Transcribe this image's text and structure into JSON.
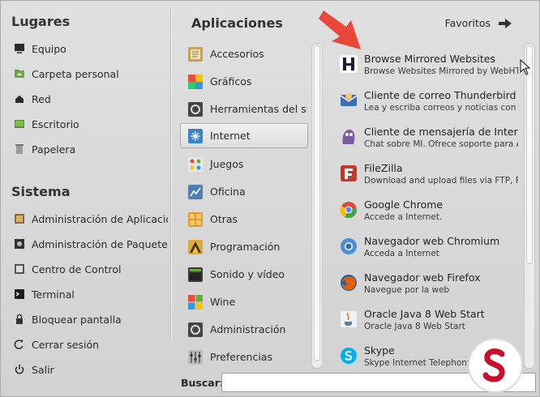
{
  "places": {
    "title": "Lugares",
    "items": [
      {
        "label": "Equipo",
        "icon": "computer-icon"
      },
      {
        "label": "Carpeta personal",
        "icon": "home-folder-icon"
      },
      {
        "label": "Red",
        "icon": "network-icon"
      },
      {
        "label": "Escritorio",
        "icon": "desktop-icon"
      },
      {
        "label": "Papelera",
        "icon": "trash-icon"
      }
    ]
  },
  "system": {
    "title": "Sistema",
    "items": [
      {
        "label": "Administración de Aplicaciones",
        "icon": "software-manager-icon"
      },
      {
        "label": "Administración de Paquetes",
        "icon": "package-manager-icon"
      },
      {
        "label": "Centro de Control",
        "icon": "control-center-icon"
      },
      {
        "label": "Terminal",
        "icon": "terminal-icon"
      },
      {
        "label": "Bloquear pantalla",
        "icon": "lock-icon"
      },
      {
        "label": "Cerrar sesión",
        "icon": "logout-icon"
      },
      {
        "label": "Salir",
        "icon": "power-icon"
      }
    ]
  },
  "applications": {
    "title": "Aplicaciones",
    "categories": [
      {
        "label": "Accesorios",
        "icon": "accessories-icon",
        "color": "#c9a15a"
      },
      {
        "label": "Gráficos",
        "icon": "graphics-icon",
        "color": "#8c4bd6"
      },
      {
        "label": "Herramientas del sistema",
        "icon": "system-tools-icon",
        "color": "#555555"
      },
      {
        "label": "Internet",
        "icon": "internet-icon",
        "color": "#3a83c9",
        "selected": true
      },
      {
        "label": "Juegos",
        "icon": "games-icon",
        "color": "#6aaa3a"
      },
      {
        "label": "Oficina",
        "icon": "office-icon",
        "color": "#4f7fb3"
      },
      {
        "label": "Otras",
        "icon": "other-icon",
        "color": "#e09a2a"
      },
      {
        "label": "Programación",
        "icon": "programming-icon",
        "color": "#e0a83a"
      },
      {
        "label": "Sonido y vídeo",
        "icon": "multimedia-icon",
        "color": "#3a3a3a"
      },
      {
        "label": "Wine",
        "icon": "wine-icon",
        "color": "#b03030"
      },
      {
        "label": "Administración",
        "icon": "administration-icon",
        "color": "#555555"
      },
      {
        "label": "Preferencias",
        "icon": "preferences-icon",
        "color": "#888888"
      }
    ]
  },
  "favorites": {
    "label": "Favoritos"
  },
  "apps": [
    {
      "name": "Browse Mirrored Websites",
      "desc": "Browse Websites Mirrored by WebHTTrack",
      "icon": "httrack-icon",
      "color": "#1a1a3a"
    },
    {
      "name": "Cliente de correo Thunderbird",
      "desc": "Lea y escriba correos y noticias con Thunderbird",
      "icon": "thunderbird-icon",
      "color": "#3b6fb3"
    },
    {
      "name": "Cliente de mensajería de Internet Pidgin",
      "desc": "Chat sobre MI. Ofrece soporte para AIM, Google Talk",
      "icon": "pidgin-icon",
      "color": "#7b5aa6"
    },
    {
      "name": "FileZilla",
      "desc": "Download and upload files via FTP, FTPS and SFTP",
      "icon": "filezilla-icon",
      "color": "#c0392b"
    },
    {
      "name": "Google Chrome",
      "desc": "Accede a Internet.",
      "icon": "chrome-icon",
      "color": "#dd4b39"
    },
    {
      "name": "Navegador web Chromium",
      "desc": "Acceda a Internet",
      "icon": "chromium-icon",
      "color": "#4a8fd8"
    },
    {
      "name": "Navegador web Firefox",
      "desc": "Navegue por la web",
      "icon": "firefox-icon",
      "color": "#e66000"
    },
    {
      "name": "Oracle Java 8 Web Start",
      "desc": "Oracle Java 8 Web Start",
      "icon": "java-icon",
      "color": "#5382a1"
    },
    {
      "name": "Skype",
      "desc": "Skype Internet Telephony",
      "icon": "skype-icon",
      "color": "#00aff0"
    }
  ],
  "search": {
    "label": "Buscar:",
    "value": ""
  },
  "colors": {
    "annotation_arrow": "#e8473a",
    "watermark": "#c8102e"
  }
}
